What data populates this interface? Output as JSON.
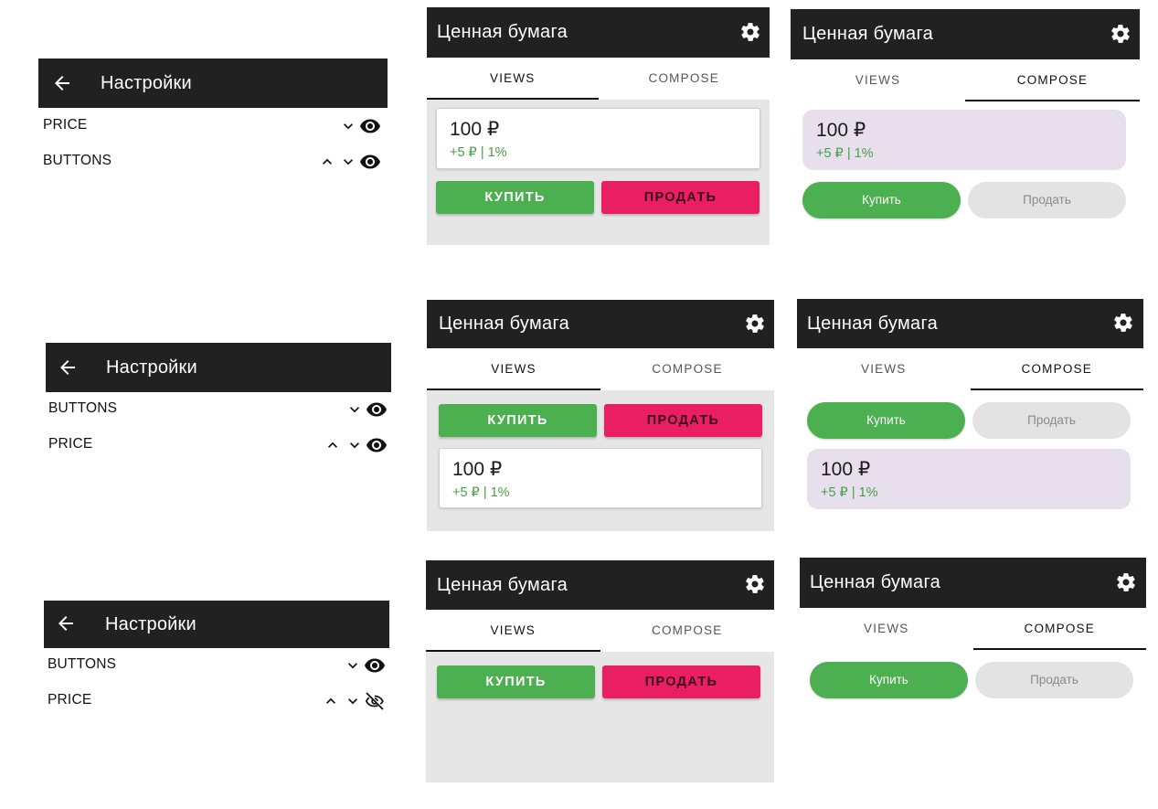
{
  "settings_panels": [
    {
      "title": "Настройки",
      "rows": [
        {
          "label": "PRICE",
          "controls": [
            "chevron-down-icon",
            "eye-icon"
          ]
        },
        {
          "label": "BUTTONS",
          "controls": [
            "chevron-up-icon",
            "chevron-down-icon",
            "eye-icon"
          ]
        }
      ]
    },
    {
      "title": "Настройки",
      "rows": [
        {
          "label": "BUTTONS",
          "controls": [
            "chevron-down-icon",
            "eye-icon"
          ]
        },
        {
          "label": "PRICE",
          "controls": [
            "chevron-up-icon",
            "chevron-down-icon",
            "eye-icon"
          ]
        }
      ]
    },
    {
      "title": "Настройки",
      "rows": [
        {
          "label": "BUTTONS",
          "controls": [
            "chevron-down-icon",
            "eye-icon"
          ]
        },
        {
          "label": "PRICE",
          "controls": [
            "chevron-up-icon",
            "chevron-down-icon",
            "eye-off-icon"
          ]
        }
      ]
    }
  ],
  "screen": {
    "title": "Ценная бумага",
    "tab_views": "VIEWS",
    "tab_compose": "COMPOSE",
    "price": "100 ₽",
    "change": "+5 ₽ | 1%",
    "views_buy": "КУПИТЬ",
    "views_sell": "ПРОДАТЬ",
    "compose_buy": "Купить",
    "compose_sell": "Продать"
  },
  "colors": {
    "appbar": "#212121",
    "buy": "#4caf50",
    "sell": "#e91e63",
    "change_text": "#43a047",
    "compose_card": "#e7e0ec",
    "compose_sell_bg": "#e3e3e3",
    "views_bg": "#e6e6e6"
  }
}
